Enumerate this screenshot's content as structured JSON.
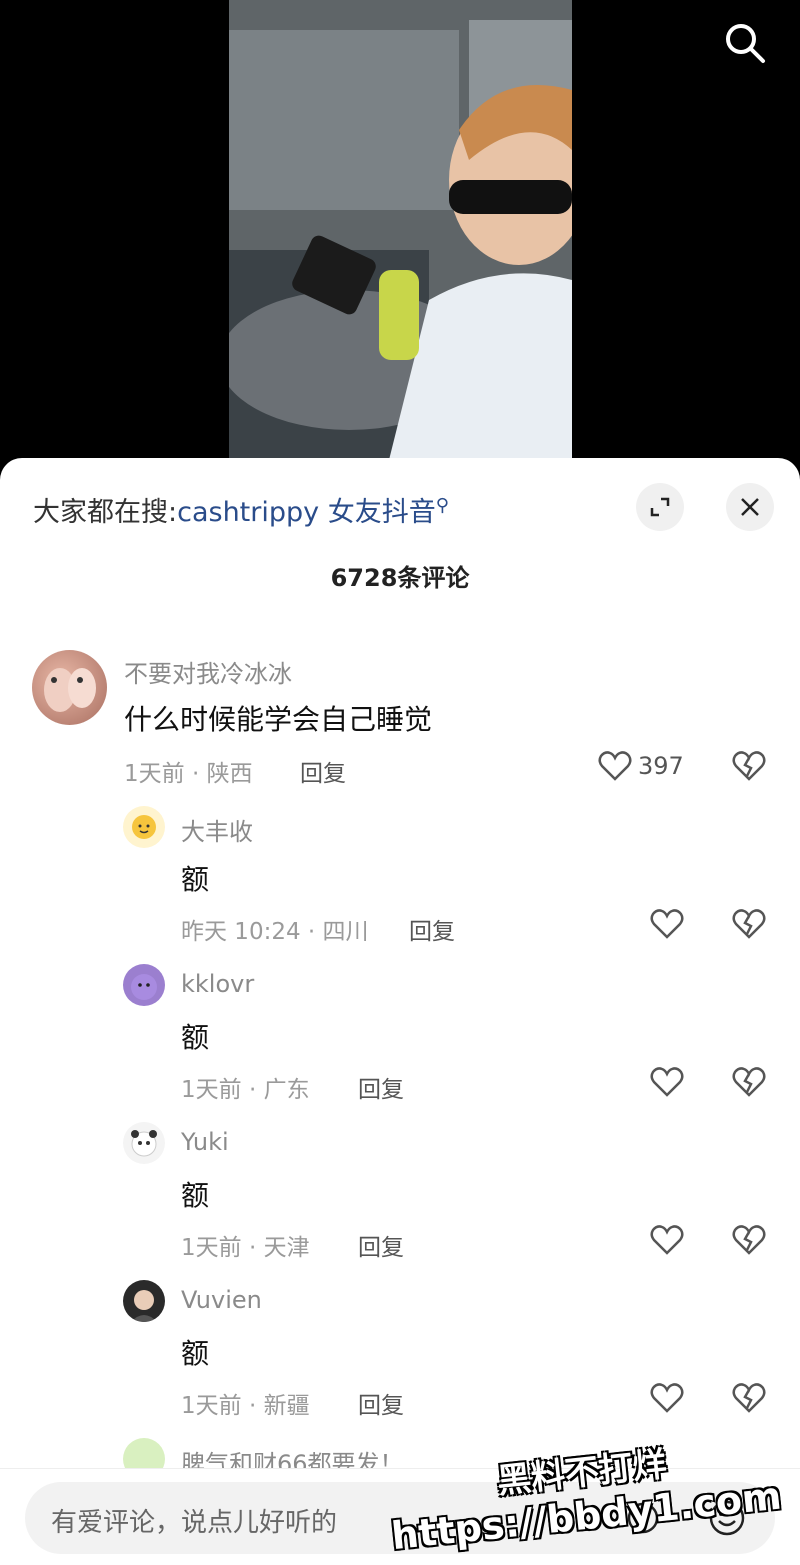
{
  "header": {
    "search_icon": "search-icon"
  },
  "sheet": {
    "trending_prefix": "大家都在搜:",
    "trending_keyword": "cashtrippy 女友抖音",
    "comment_count": "6728条评论"
  },
  "comments": [
    {
      "user": "不要对我冷冰冰",
      "text": "什么时候能学会自己睡觉",
      "time_loc": "1天前 · 陕西",
      "reply": "回复",
      "likes": "397"
    }
  ],
  "replies": [
    {
      "user": "大丰收",
      "text": "额",
      "time_loc": "昨天 10:24 · 四川",
      "reply": "回复"
    },
    {
      "user": "kklovr",
      "text": "额",
      "time_loc": "1天前 · 广东",
      "reply": "回复"
    },
    {
      "user": "Yuki",
      "text": "额",
      "time_loc": "1天前 · 天津",
      "reply": "回复"
    },
    {
      "user": "Vuvien",
      "text": "额",
      "time_loc": "1天前 · 新疆",
      "reply": "回复"
    },
    {
      "user": "脾气和财66都要发！"
    }
  ],
  "input": {
    "placeholder": "有爱评论，说点儿好听的"
  },
  "watermark": {
    "line1": "黑料不打烊",
    "line2": "https://bbdy1.com"
  },
  "colors": {
    "accent": "#2a4c8a",
    "muted": "#8a8a8a"
  }
}
